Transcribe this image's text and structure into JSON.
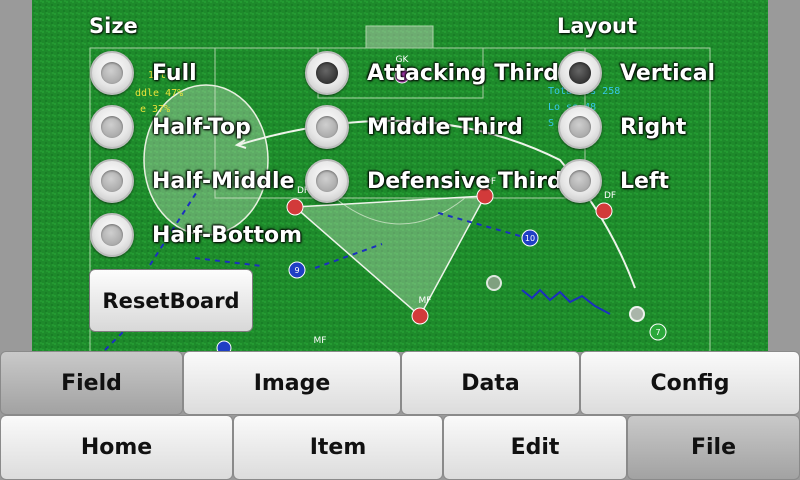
{
  "size": {
    "title": "Size",
    "options": [
      {
        "label": "Full",
        "checked": false
      },
      {
        "label": "Half-Top",
        "checked": false
      },
      {
        "label": "Half-Middle",
        "checked": false
      },
      {
        "label": "Half-Bottom",
        "checked": false
      }
    ]
  },
  "area": {
    "options": [
      {
        "label": "Attacking Third",
        "checked": true
      },
      {
        "label": "Middle Third",
        "checked": false
      },
      {
        "label": "Defensive Third",
        "checked": false
      }
    ]
  },
  "layout": {
    "title": "Layout",
    "options": [
      {
        "label": "Vertical",
        "checked": true
      },
      {
        "label": "Right",
        "checked": false
      },
      {
        "label": "Left",
        "checked": false
      }
    ]
  },
  "reset_button": "ResetBoard",
  "tabs_top": [
    {
      "label": "Field",
      "active": true
    },
    {
      "label": "Image",
      "active": false
    },
    {
      "label": "Data",
      "active": false
    },
    {
      "label": "Config",
      "active": false
    }
  ],
  "tabs_bottom": [
    {
      "label": "Home",
      "active": false
    },
    {
      "label": "Item",
      "active": false
    },
    {
      "label": "Edit",
      "active": false
    },
    {
      "label": "File",
      "active": true
    }
  ],
  "board": {
    "player_labels": [
      "GK",
      "DF",
      "DF",
      "DF",
      "MF",
      "MF"
    ],
    "player_numbers": [
      "9",
      "10",
      "7"
    ],
    "stats_left": [
      "1st",
      "ddle 47%",
      "e 37%"
    ],
    "stats_right": [
      "Total ss 258",
      "Lo ss 48",
      "S"
    ]
  },
  "colors": {
    "pitch": "#1f8a2c",
    "red_player": "#d23a3a",
    "blue_player": "#1f3fc4",
    "green_player": "#2aa83a"
  }
}
